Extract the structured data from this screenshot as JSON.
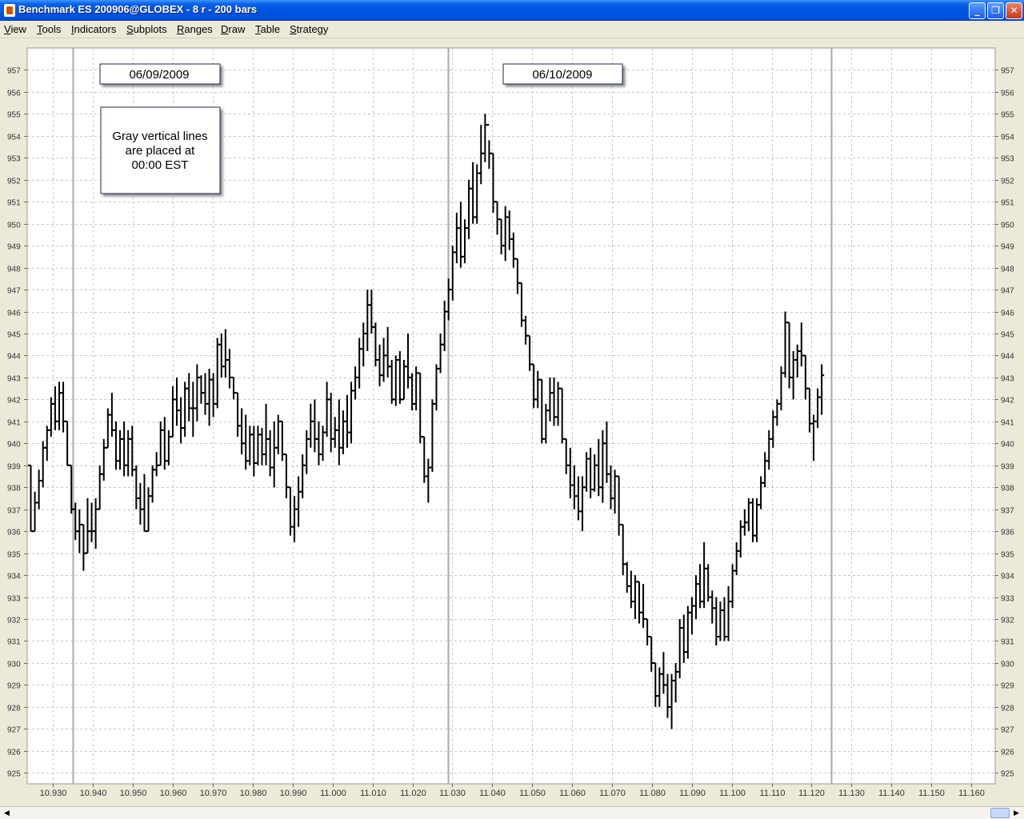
{
  "window": {
    "title": "Benchmark ES 200906@GLOBEX - 8 r - 200 bars",
    "buttons": {
      "minimize": "_",
      "maximize": "❐",
      "close": "✕"
    }
  },
  "menu": [
    {
      "first": "V",
      "rest": "iew"
    },
    {
      "first": "T",
      "rest": "ools"
    },
    {
      "first": "I",
      "rest": "ndicators"
    },
    {
      "first": "S",
      "rest": "ubplots"
    },
    {
      "first": "R",
      "rest": "anges"
    },
    {
      "first": "D",
      "rest": "raw"
    },
    {
      "first": "T",
      "rest": "able"
    },
    {
      "first": "S",
      "rest": "trategy"
    }
  ],
  "annotations": {
    "date1": "06/09/2009",
    "date2": "06/10/2009",
    "note_lines": [
      "Gray vertical lines",
      "are placed at",
      "00:00 EST"
    ]
  },
  "colors": {
    "plot_bg": "#FFFFFF",
    "grid": "#C8C8C8",
    "bars": "#000000",
    "session_line": "#A8A8A8"
  },
  "chart_data": {
    "type": "ohlc",
    "y_range": [
      924.5,
      958
    ],
    "y_ticks": [
      957,
      956,
      955,
      954,
      953,
      952,
      951,
      950,
      949,
      948,
      947,
      946,
      945,
      944,
      943,
      942,
      941,
      940,
      939,
      938,
      937,
      936,
      935,
      934,
      933,
      932,
      931,
      930,
      929,
      928,
      927,
      926,
      925
    ],
    "x_range": [
      10.9235,
      11.166
    ],
    "x_ticks": [
      "10.930",
      "10.940",
      "10.950",
      "10.960",
      "10.970",
      "10.980",
      "10.990",
      "11.000",
      "11.010",
      "11.020",
      "11.030",
      "11.040",
      "11.050",
      "11.060",
      "11.070",
      "11.080",
      "11.090",
      "11.100",
      "11.110",
      "11.120",
      "11.130",
      "11.140",
      "11.150",
      "11.160"
    ],
    "session_lines_x": [
      10.9349,
      11.0289,
      11.1249
    ],
    "bars": [
      [
        939.0,
        939.0,
        936.0,
        936.0
      ],
      [
        936.0,
        937.8,
        936.0,
        937.3
      ],
      [
        937.3,
        938.8,
        937.0,
        938.3
      ],
      [
        938.3,
        940.1,
        938.0,
        939.8
      ],
      [
        939.8,
        940.8,
        939.2,
        940.6
      ],
      [
        940.6,
        942.1,
        940.3,
        941.8
      ],
      [
        941.8,
        942.6,
        940.6,
        941.0
      ],
      [
        941.0,
        942.8,
        940.6,
        942.3
      ],
      [
        942.3,
        942.8,
        940.5,
        941.0
      ],
      [
        941.0,
        941.0,
        939.0,
        939.0
      ],
      [
        939.0,
        939.0,
        936.8,
        937.0
      ],
      [
        937.0,
        937.3,
        935.6,
        936.0
      ],
      [
        936.0,
        937.0,
        935.0,
        936.3
      ],
      [
        936.3,
        936.3,
        934.2,
        935.0
      ],
      [
        935.0,
        937.5,
        935.0,
        936.0
      ],
      [
        936.0,
        937.3,
        935.5,
        936.0
      ],
      [
        936.0,
        937.5,
        935.2,
        937.0
      ],
      [
        937.0,
        939.0,
        937.0,
        938.6
      ],
      [
        938.6,
        940.2,
        938.3,
        939.8
      ],
      [
        939.8,
        941.6,
        939.8,
        941.3
      ],
      [
        941.3,
        942.3,
        940.3,
        940.6
      ],
      [
        940.6,
        941.0,
        938.8,
        939.2
      ],
      [
        939.2,
        940.6,
        938.8,
        940.2
      ],
      [
        940.2,
        941.0,
        938.5,
        939.0
      ],
      [
        939.0,
        940.6,
        938.5,
        940.2
      ],
      [
        940.2,
        940.8,
        938.5,
        938.8
      ],
      [
        938.8,
        939.0,
        937.0,
        937.5
      ],
      [
        937.5,
        938.2,
        936.3,
        937.0
      ],
      [
        937.0,
        938.6,
        936.0,
        936.0
      ],
      [
        936.0,
        938.0,
        936.0,
        937.6
      ],
      [
        937.6,
        939.0,
        937.3,
        938.8
      ],
      [
        938.8,
        939.6,
        938.5,
        939.0
      ],
      [
        939.0,
        941.0,
        939.0,
        940.6
      ],
      [
        940.6,
        941.2,
        938.8,
        939.2
      ],
      [
        939.2,
        940.6,
        939.0,
        940.3
      ],
      [
        940.3,
        942.6,
        940.3,
        942.0
      ],
      [
        942.0,
        943.0,
        940.8,
        941.5
      ],
      [
        941.5,
        942.1,
        940.0,
        940.7
      ],
      [
        940.7,
        942.8,
        940.3,
        942.5
      ],
      [
        942.5,
        943.2,
        941.0,
        941.6
      ],
      [
        941.6,
        942.8,
        940.3,
        941.6
      ],
      [
        941.6,
        943.6,
        941.0,
        943.0
      ],
      [
        943.0,
        943.1,
        941.8,
        942.3
      ],
      [
        942.3,
        943.2,
        941.3,
        941.8
      ],
      [
        941.8,
        943.4,
        940.8,
        942.9
      ],
      [
        942.9,
        943.2,
        941.2,
        941.8
      ],
      [
        941.8,
        944.8,
        941.6,
        944.5
      ],
      [
        944.5,
        945.0,
        943.0,
        943.5
      ],
      [
        943.5,
        945.2,
        943.0,
        943.8
      ],
      [
        943.8,
        944.3,
        942.5,
        943.0
      ],
      [
        943.0,
        943.0,
        942.0,
        942.3
      ],
      [
        942.3,
        942.3,
        940.3,
        940.8
      ],
      [
        940.8,
        941.6,
        939.5,
        940.0
      ],
      [
        940.0,
        941.3,
        938.8,
        939.2
      ],
      [
        939.2,
        940.8,
        939.0,
        940.4
      ],
      [
        940.4,
        940.8,
        938.5,
        939.1
      ],
      [
        939.1,
        940.8,
        939.0,
        940.4
      ],
      [
        940.4,
        940.7,
        939.0,
        939.5
      ],
      [
        939.5,
        941.8,
        939.0,
        940.2
      ],
      [
        940.2,
        940.6,
        938.5,
        938.9
      ],
      [
        938.9,
        941.0,
        938.0,
        939.8
      ],
      [
        939.8,
        941.3,
        939.5,
        941.0
      ],
      [
        941.0,
        941.0,
        939.2,
        939.5
      ],
      [
        939.5,
        939.5,
        937.5,
        938.0
      ],
      [
        938.0,
        938.0,
        935.8,
        936.2
      ],
      [
        936.2,
        937.6,
        935.5,
        937.0
      ],
      [
        937.0,
        938.5,
        936.2,
        937.8
      ],
      [
        937.8,
        939.5,
        937.5,
        939.0
      ],
      [
        939.0,
        940.6,
        938.6,
        940.2
      ],
      [
        940.2,
        941.8,
        939.8,
        941.0
      ],
      [
        941.0,
        942.0,
        939.6,
        940.2
      ],
      [
        940.2,
        941.0,
        939.0,
        939.5
      ],
      [
        939.5,
        940.8,
        939.2,
        940.5
      ],
      [
        940.5,
        942.8,
        940.3,
        942.0
      ],
      [
        942.0,
        942.3,
        939.6,
        940.2
      ],
      [
        940.2,
        941.2,
        939.8,
        940.6
      ],
      [
        940.6,
        942.0,
        939.0,
        939.8
      ],
      [
        939.8,
        941.5,
        939.5,
        941.0
      ],
      [
        941.0,
        942.2,
        939.8,
        940.5
      ],
      [
        940.5,
        942.8,
        940.0,
        942.4
      ],
      [
        942.4,
        943.5,
        942.0,
        943.0
      ],
      [
        943.0,
        944.8,
        942.5,
        944.3
      ],
      [
        944.3,
        945.5,
        943.5,
        945.0
      ],
      [
        945.0,
        947.0,
        944.2,
        946.3
      ],
      [
        946.3,
        947.0,
        945.0,
        945.3
      ],
      [
        945.3,
        945.5,
        943.5,
        943.8
      ],
      [
        943.8,
        944.5,
        942.6,
        943.1
      ],
      [
        943.1,
        944.8,
        942.8,
        944.0
      ],
      [
        944.0,
        945.3,
        943.0,
        943.5
      ],
      [
        943.5,
        943.8,
        941.8,
        942.0
      ],
      [
        942.0,
        944.0,
        941.7,
        943.8
      ],
      [
        943.8,
        944.2,
        941.8,
        942.0
      ],
      [
        942.0,
        943.8,
        942.0,
        943.5
      ],
      [
        943.5,
        945.0,
        942.5,
        943.0
      ],
      [
        943.0,
        943.2,
        941.5,
        941.8
      ],
      [
        941.8,
        943.5,
        941.5,
        943.2
      ],
      [
        943.2,
        943.2,
        940.0,
        940.3
      ],
      [
        940.3,
        940.3,
        938.2,
        938.5
      ],
      [
        938.5,
        939.3,
        937.3,
        938.9
      ],
      [
        938.9,
        942.0,
        938.7,
        941.8
      ],
      [
        941.8,
        943.6,
        941.5,
        943.4
      ],
      [
        943.4,
        945.0,
        943.2,
        944.5
      ],
      [
        944.5,
        946.5,
        944.2,
        946.0
      ],
      [
        946.0,
        947.5,
        945.6,
        947.0
      ],
      [
        947.0,
        949.0,
        946.5,
        948.7
      ],
      [
        948.7,
        950.5,
        948.2,
        949.8
      ],
      [
        949.8,
        951.0,
        948.0,
        948.5
      ],
      [
        948.5,
        950.2,
        948.2,
        949.8
      ],
      [
        949.8,
        952.0,
        949.3,
        951.6
      ],
      [
        951.6,
        952.8,
        950.0,
        950.3
      ],
      [
        950.3,
        952.7,
        950.0,
        952.3
      ],
      [
        952.3,
        954.5,
        951.8,
        953.2
      ],
      [
        953.2,
        955.0,
        952.8,
        954.5
      ],
      [
        954.5,
        953.8,
        952.5,
        953.2
      ],
      [
        953.2,
        953.2,
        950.5,
        951.0
      ],
      [
        951.0,
        951.0,
        949.5,
        950.2
      ],
      [
        950.2,
        950.2,
        948.6,
        949.0
      ],
      [
        949.0,
        950.8,
        948.3,
        950.3
      ],
      [
        950.3,
        950.6,
        948.8,
        949.3
      ],
      [
        949.3,
        949.6,
        948.0,
        948.4
      ],
      [
        948.4,
        948.4,
        946.8,
        947.3
      ],
      [
        947.3,
        947.3,
        945.3,
        945.6
      ],
      [
        945.6,
        945.8,
        944.5,
        944.9
      ],
      [
        944.9,
        944.9,
        943.3,
        943.6
      ],
      [
        943.6,
        943.6,
        941.6,
        942.0
      ],
      [
        942.0,
        943.3,
        941.6,
        942.9
      ],
      [
        942.9,
        942.9,
        940.0,
        940.2
      ],
      [
        940.2,
        941.8,
        940.0,
        941.5
      ],
      [
        941.5,
        943.0,
        941.0,
        942.3
      ],
      [
        942.3,
        943.0,
        940.8,
        941.2
      ],
      [
        941.2,
        942.8,
        940.8,
        942.5
      ],
      [
        942.5,
        942.5,
        940.0,
        940.2
      ],
      [
        940.2,
        940.2,
        938.6,
        939.0
      ],
      [
        939.0,
        939.8,
        937.5,
        938.1
      ],
      [
        938.1,
        939.0,
        937.0,
        937.6
      ],
      [
        937.6,
        938.5,
        936.5,
        936.9
      ],
      [
        936.9,
        938.5,
        936.0,
        938.0
      ],
      [
        938.0,
        939.6,
        937.8,
        939.3
      ],
      [
        939.3,
        939.8,
        937.5,
        937.9
      ],
      [
        937.9,
        939.5,
        937.8,
        939.0
      ],
      [
        939.0,
        940.2,
        937.6,
        938.0
      ],
      [
        938.0,
        940.6,
        937.3,
        940.0
      ],
      [
        940.0,
        941.0,
        938.2,
        938.6
      ],
      [
        938.6,
        939.0,
        937.0,
        937.5
      ],
      [
        937.5,
        938.8,
        936.8,
        938.5
      ],
      [
        938.5,
        938.5,
        935.8,
        936.3
      ],
      [
        936.3,
        936.3,
        934.0,
        934.5
      ],
      [
        934.5,
        934.6,
        933.2,
        933.5
      ],
      [
        933.5,
        934.2,
        932.5,
        932.8
      ],
      [
        932.8,
        934.0,
        932.0,
        933.7
      ],
      [
        933.7,
        933.7,
        931.8,
        932.3
      ],
      [
        932.3,
        933.6,
        931.6,
        932.0
      ],
      [
        932.0,
        932.0,
        930.8,
        931.2
      ],
      [
        931.2,
        931.2,
        929.6,
        930.0
      ],
      [
        930.0,
        930.0,
        928.0,
        928.5
      ],
      [
        928.5,
        929.8,
        928.0,
        929.5
      ],
      [
        929.5,
        930.5,
        928.6,
        929.0
      ],
      [
        929.0,
        929.5,
        927.5,
        928.0
      ],
      [
        928.0,
        929.5,
        927.0,
        929.2
      ],
      [
        929.2,
        930.0,
        928.2,
        929.6
      ],
      [
        929.6,
        932.0,
        929.3,
        931.6
      ],
      [
        931.6,
        932.2,
        930.0,
        930.5
      ],
      [
        930.5,
        932.6,
        930.2,
        932.3
      ],
      [
        932.3,
        933.0,
        931.3,
        932.6
      ],
      [
        932.6,
        934.0,
        932.0,
        933.6
      ],
      [
        933.6,
        934.5,
        932.5,
        932.8
      ],
      [
        932.8,
        935.5,
        932.5,
        934.3
      ],
      [
        934.3,
        934.5,
        932.8,
        933.0
      ],
      [
        933.0,
        933.3,
        931.8,
        932.5
      ],
      [
        932.5,
        933.0,
        930.8,
        931.2
      ],
      [
        931.2,
        932.8,
        931.0,
        932.4
      ],
      [
        932.4,
        933.0,
        931.0,
        931.2
      ],
      [
        931.2,
        933.5,
        931.0,
        932.8
      ],
      [
        932.8,
        934.5,
        932.5,
        934.2
      ],
      [
        934.2,
        935.5,
        934.0,
        935.1
      ],
      [
        935.1,
        936.5,
        934.8,
        936.2
      ],
      [
        936.2,
        937.0,
        935.8,
        936.4
      ],
      [
        936.4,
        937.5,
        936.0,
        937.3
      ],
      [
        937.3,
        937.5,
        935.5,
        935.8
      ],
      [
        935.8,
        937.5,
        935.5,
        937.2
      ],
      [
        937.2,
        938.5,
        937.0,
        938.2
      ],
      [
        938.2,
        939.6,
        938.0,
        939.2
      ],
      [
        939.2,
        940.6,
        938.8,
        940.2
      ],
      [
        940.2,
        941.5,
        939.8,
        941.2
      ],
      [
        941.2,
        942.0,
        940.8,
        941.8
      ],
      [
        941.8,
        943.5,
        941.5,
        943.2
      ],
      [
        943.2,
        946.0,
        943.0,
        945.5
      ],
      [
        945.5,
        945.5,
        942.5,
        943.0
      ],
      [
        943.0,
        944.2,
        942.0,
        943.8
      ],
      [
        943.8,
        944.5,
        943.0,
        944.2
      ],
      [
        944.2,
        945.5,
        943.5,
        944.0
      ],
      [
        944.0,
        944.0,
        942.0,
        942.5
      ],
      [
        942.5,
        942.5,
        940.5,
        940.9
      ],
      [
        940.9,
        941.3,
        939.2,
        941.0
      ],
      [
        941.0,
        942.5,
        940.7,
        942.1
      ],
      [
        942.1,
        943.6,
        941.3,
        943.1
      ]
    ]
  }
}
